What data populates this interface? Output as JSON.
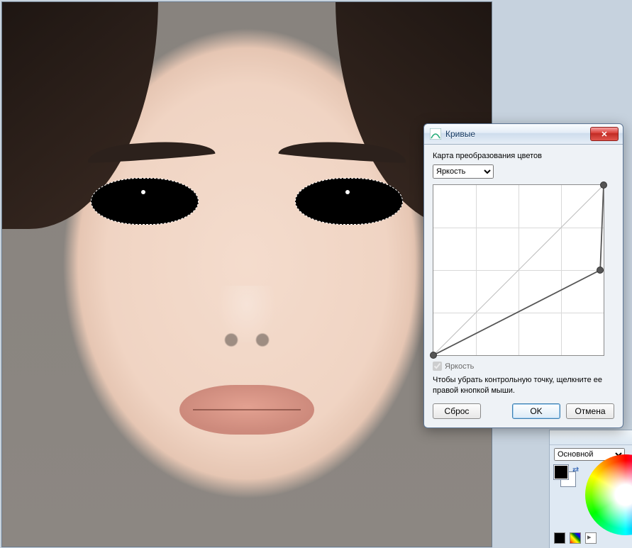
{
  "dialog": {
    "title": "Кривые",
    "section_label": "Карта преобразования цветов",
    "channel_options": [
      "Яркость"
    ],
    "channel_selected": "Яркость",
    "brightness_checkbox_label": "Яркость",
    "brightness_checked": true,
    "hint": "Чтобы убрать контрольную точку, щелкните ее правой кнопкой мыши.",
    "reset_label": "Сброс",
    "ok_label": "OK",
    "cancel_label": "Отмена",
    "curve": {
      "grid_divisions": 4,
      "points": [
        {
          "x": 0.0,
          "y": 0.0
        },
        {
          "x": 0.98,
          "y": 0.5
        },
        {
          "x": 1.0,
          "y": 1.0
        }
      ]
    }
  },
  "color_panel": {
    "mode_options": [
      "Основной"
    ],
    "mode_selected": "Основной",
    "primary_color": "#000000",
    "secondary_color": "#ffffff"
  }
}
